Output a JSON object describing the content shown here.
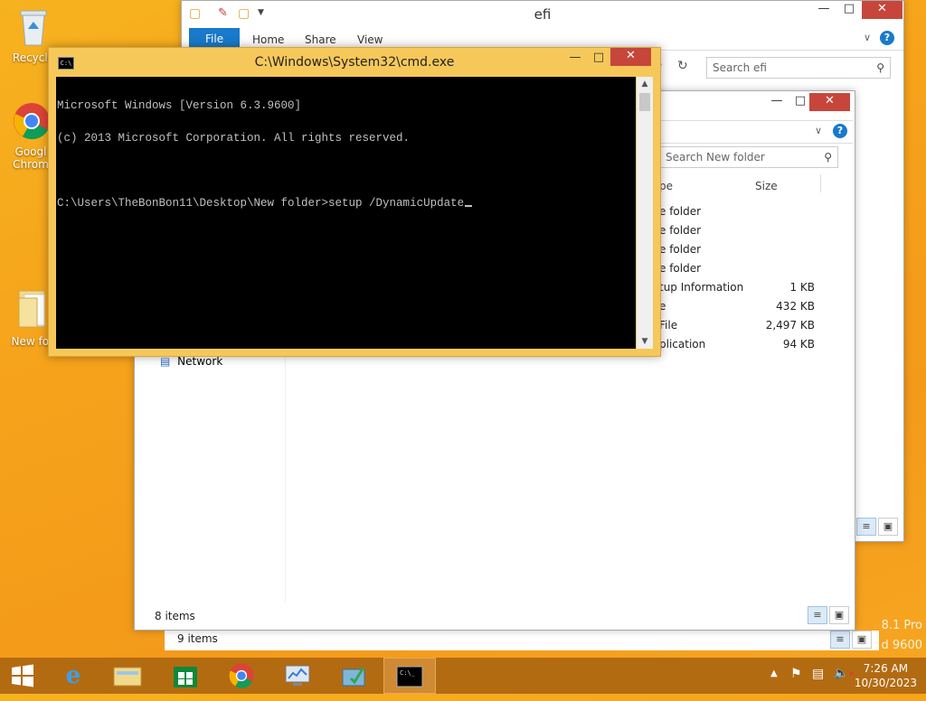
{
  "desktop": {
    "icons": [
      {
        "label": "Recycle",
        "icon": "recycle-bin-icon"
      },
      {
        "label": "Googl Chrom",
        "icon": "chrome-icon"
      },
      {
        "label": "New fol",
        "icon": "folder-icon"
      }
    ],
    "watermark": [
      "8.1 Pro",
      "d 9600"
    ]
  },
  "explorer_efi": {
    "title": "efi",
    "tabs": [
      "File",
      "Home",
      "Share",
      "View"
    ],
    "search_placeholder": "Search efi",
    "status": "9 items"
  },
  "explorer_new_folder": {
    "search_placeholder": "Search New folder",
    "columns": {
      "type": "pe",
      "size": "Size"
    },
    "rows": [
      {
        "type": "e folder",
        "size": ""
      },
      {
        "type": "e folder",
        "size": ""
      },
      {
        "type": "e folder",
        "size": ""
      },
      {
        "type": "e folder",
        "size": ""
      },
      {
        "type": "tup Information",
        "size": "1 KB"
      },
      {
        "type": "e",
        "size": "432 KB"
      },
      {
        "type": "File",
        "size": "2,497 KB"
      },
      {
        "type": "plication",
        "size": "94 KB"
      }
    ],
    "nav_network": "Network",
    "status": "8 items"
  },
  "cmd": {
    "title": "C:\\Windows\\System32\\cmd.exe",
    "lines": [
      "Microsoft Windows [Version 6.3.9600]",
      "(c) 2013 Microsoft Corporation. All rights reserved.",
      "",
      "C:\\Users\\TheBonBon11\\Desktop\\New folder>setup /DynamicUpdate"
    ]
  },
  "taskbar": {
    "apps": [
      {
        "name": "start",
        "icon": "windows-logo-icon"
      },
      {
        "name": "internet-explorer",
        "icon": "ie-icon"
      },
      {
        "name": "file-explorer",
        "icon": "file-explorer-icon"
      },
      {
        "name": "store",
        "icon": "store-icon"
      },
      {
        "name": "chrome",
        "icon": "chrome-icon"
      },
      {
        "name": "app5",
        "icon": "monitor-icon"
      },
      {
        "name": "app6",
        "icon": "install-icon"
      },
      {
        "name": "cmd",
        "icon": "cmd-icon"
      }
    ],
    "time": "7:26 AM",
    "date": "10/30/2023"
  },
  "colors": {
    "desktop": "#f6a51d",
    "taskbar": "#b36b12",
    "cmd_frame": "#f6c85a",
    "close": "#c7463b",
    "file_tab": "#1979ca"
  }
}
